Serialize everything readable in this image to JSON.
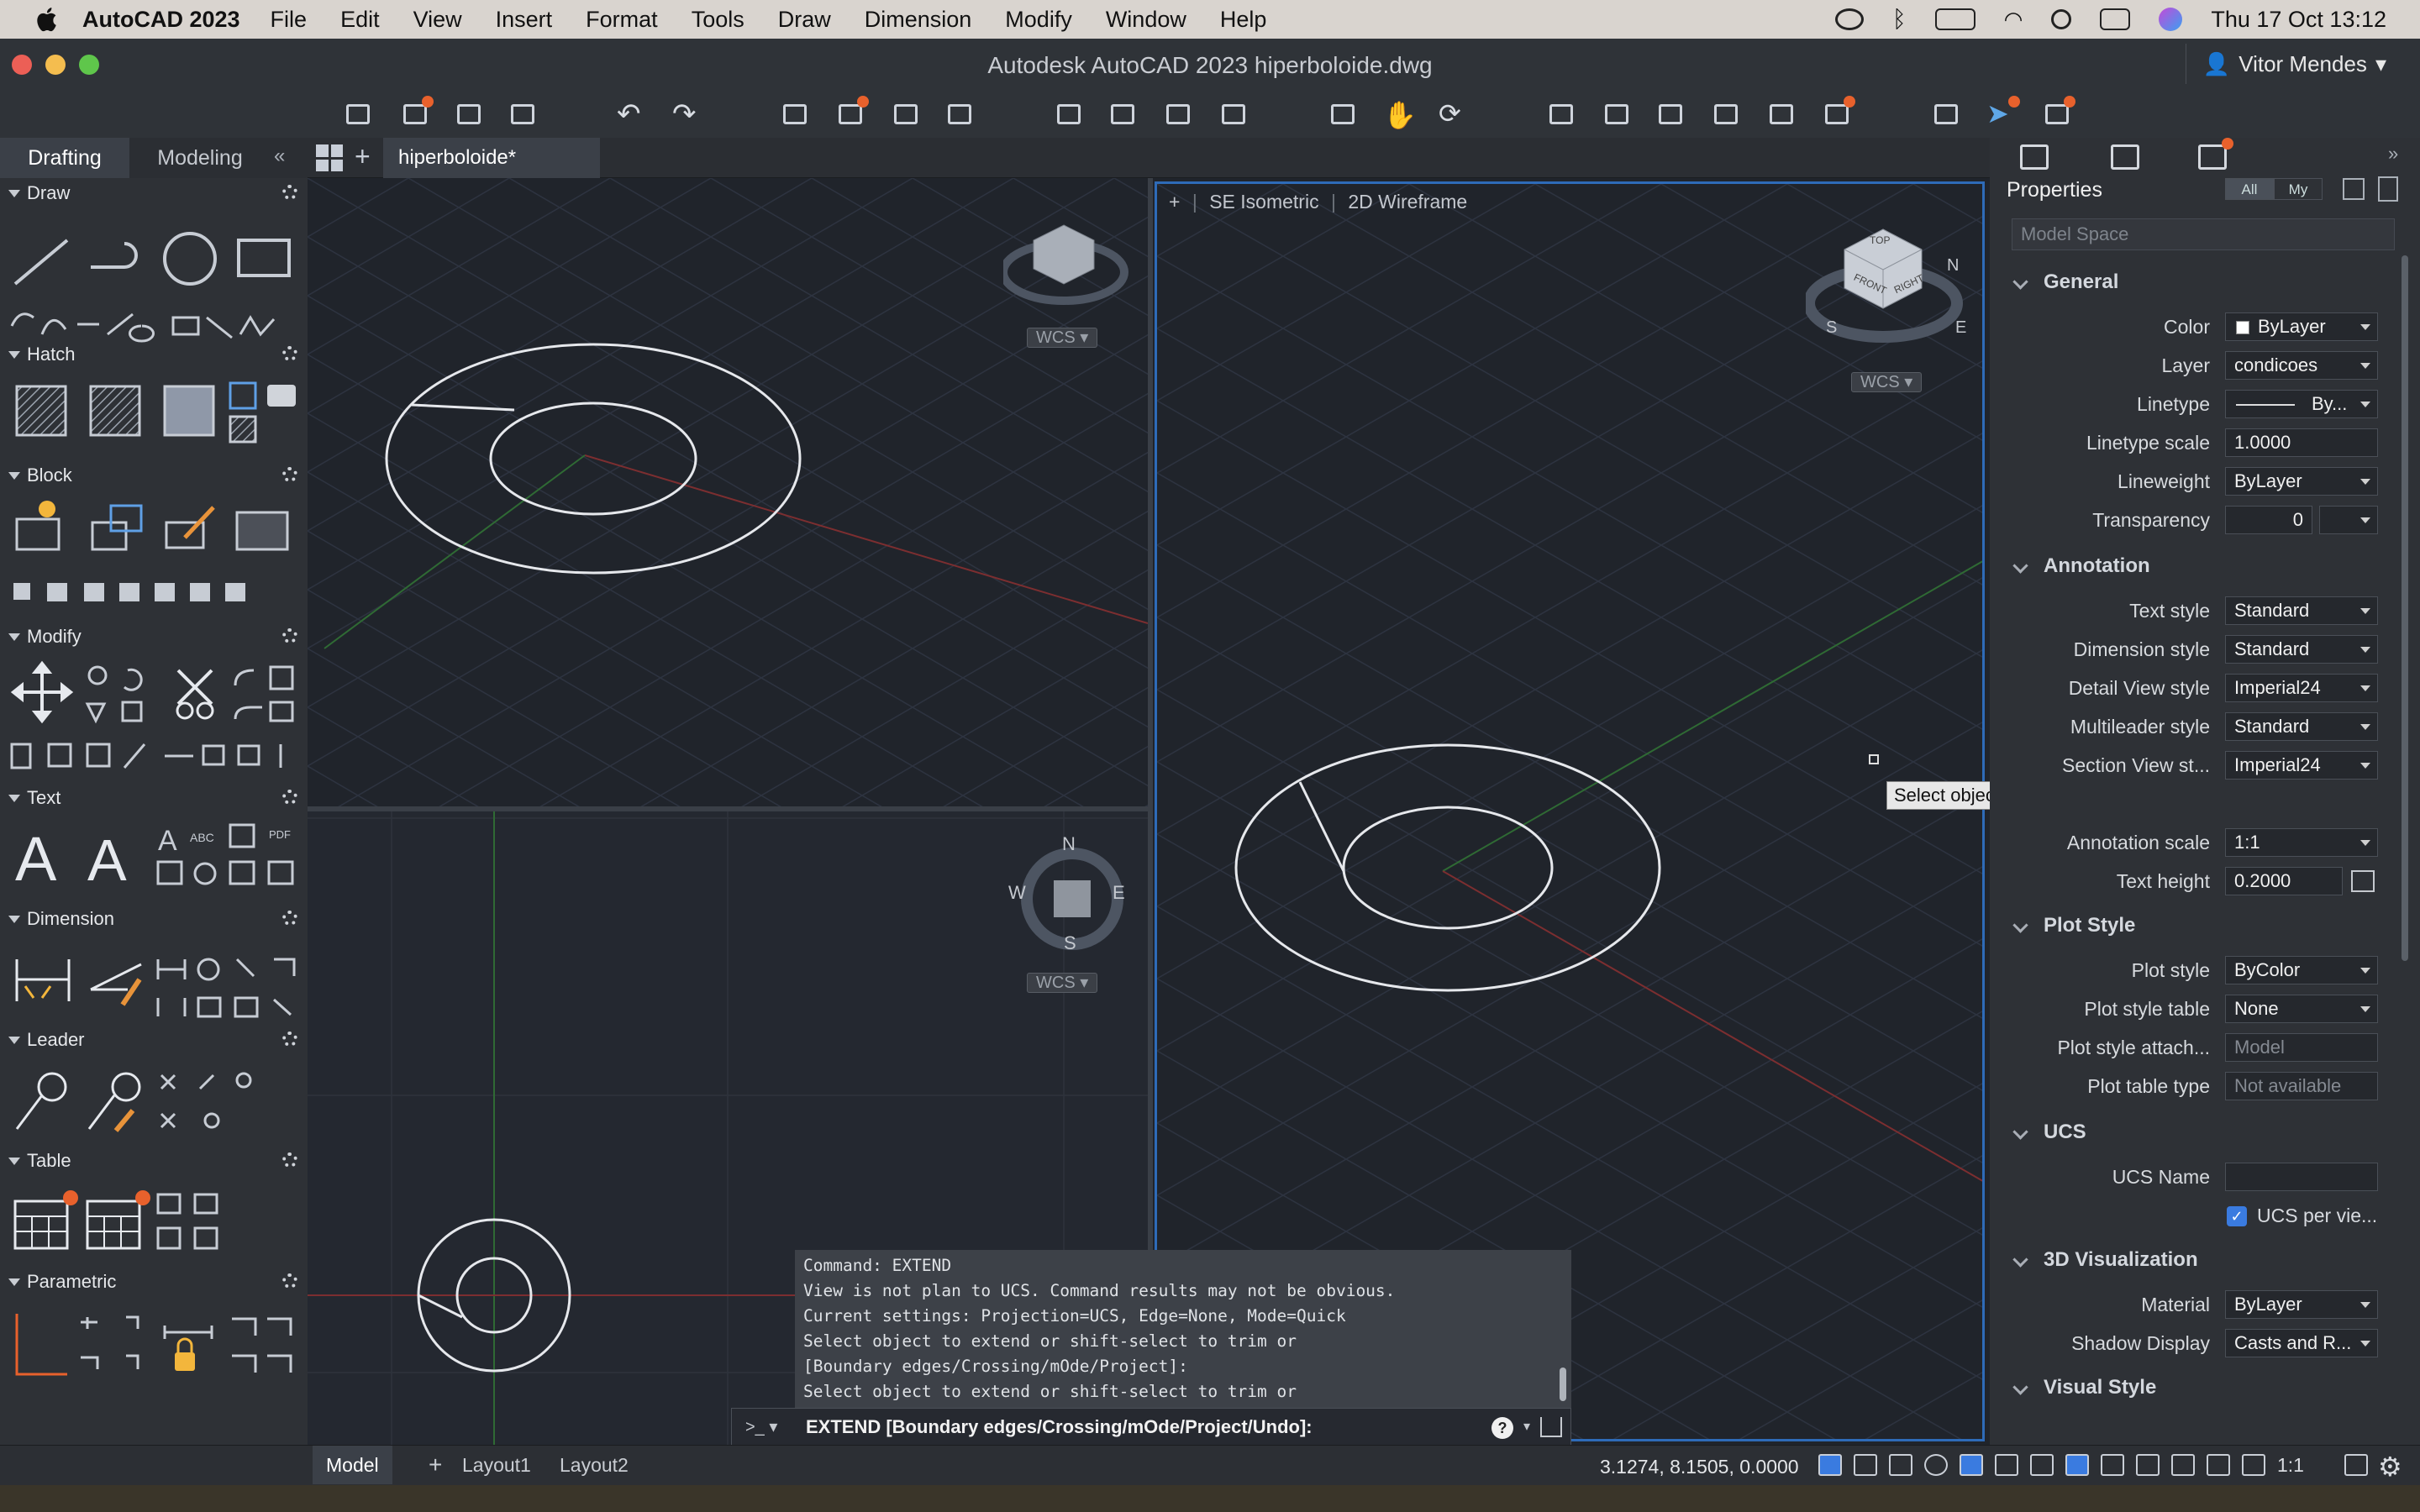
{
  "menubar": {
    "app_name": "AutoCAD 2023",
    "items": [
      "File",
      "Edit",
      "View",
      "Insert",
      "Format",
      "Tools",
      "Draw",
      "Dimension",
      "Modify",
      "Window",
      "Help"
    ],
    "datetime": "Thu 17 Oct  13:12"
  },
  "window": {
    "title": "Autodesk AutoCAD 2023    hiperboloide.dwg",
    "user": "Vitor Mendes"
  },
  "palette": {
    "tabs": [
      "Drafting",
      "Modeling"
    ],
    "sections": [
      "Draw",
      "Hatch",
      "Block",
      "Modify",
      "Text",
      "Dimension",
      "Leader",
      "Table",
      "Parametric"
    ]
  },
  "doc_tab": "hiperboloide*",
  "viewport_right": {
    "label_plus": "+",
    "view": "SE Isometric",
    "style": "2D Wireframe"
  },
  "viewcube": {
    "wcs": "WCS",
    "top": "TOP",
    "front": "FRONT",
    "right": "RIGHT",
    "n": "N",
    "s": "S",
    "e": "E",
    "w": "W"
  },
  "command": {
    "history": [
      "Command: EXTEND",
      "View is not plan to UCS. Command results may not be obvious.",
      "Current settings: Projection=UCS, Edge=None, Mode=Quick",
      "Select object to extend or shift-select to trim or",
      " [Boundary edges/Crossing/mOde/Project]:",
      "Select object to extend or shift-select to trim or"
    ],
    "prompt_icon": ">_",
    "current": "EXTEND  [Boundary edges/Crossing/mOde/Project/Undo]:"
  },
  "tooltip": "Select object to extend or shift-select to trim or",
  "properties": {
    "title": "Properties",
    "filter_all": "All",
    "filter_my": "My",
    "selection": "Model Space",
    "categories": {
      "general": "General",
      "annotation": "Annotation",
      "plot_style": "Plot Style",
      "ucs": "UCS",
      "visualization": "3D Visualization",
      "visual_style": "Visual Style"
    },
    "general": {
      "color_label": "Color",
      "color_value": "ByLayer",
      "layer_label": "Layer",
      "layer_value": "condicoes",
      "linetype_label": "Linetype",
      "linetype_value": "By...",
      "ltscale_label": "Linetype scale",
      "ltscale_value": "1.0000",
      "lineweight_label": "Lineweight",
      "lineweight_value": "ByLayer",
      "transparency_label": "Transparency",
      "transparency_value": "0"
    },
    "annotation": {
      "textstyle_label": "Text style",
      "textstyle_value": "Standard",
      "dimstyle_label": "Dimension style",
      "dimstyle_value": "Standard",
      "detail_label": "Detail View style",
      "detail_value": "Imperial24",
      "mleader_label": "Multileader style",
      "mleader_value": "Standard",
      "section_label": "Section View st...",
      "section_value": "Imperial24",
      "annoscale_label": "Annotation scale",
      "annoscale_value": "1:1",
      "textheight_label": "Text height",
      "textheight_value": "0.2000"
    },
    "plot": {
      "plotstyle_label": "Plot style",
      "plotstyle_value": "ByColor",
      "table_label": "Plot style table",
      "table_value": "None",
      "attach_label": "Plot style attach...",
      "attach_value": "Model",
      "type_label": "Plot table type",
      "type_value": "Not available"
    },
    "ucs": {
      "name_label": "UCS Name",
      "name_value": "",
      "perview_label": "UCS per vie..."
    },
    "viz": {
      "material_label": "Material",
      "material_value": "ByLayer",
      "shadow_label": "Shadow Display",
      "shadow_value": "Casts and R..."
    }
  },
  "status": {
    "tabs": [
      "Model",
      "Layout1",
      "Layout2"
    ],
    "coords": "3.1274, 8.1505, 0.0000",
    "scale": "1:1"
  }
}
